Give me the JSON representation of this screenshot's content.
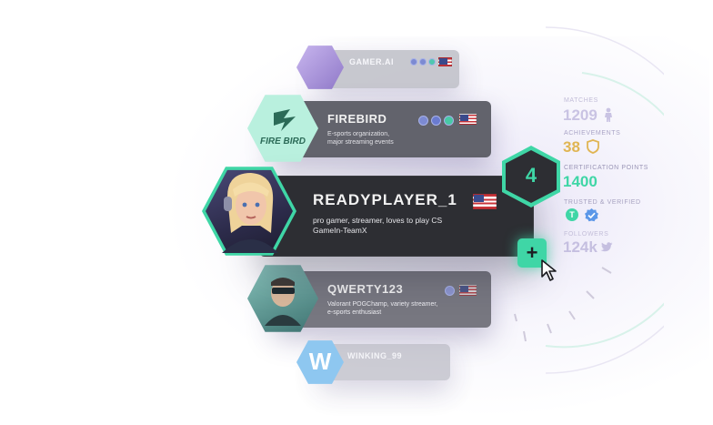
{
  "players": {
    "gamer_ai": {
      "name": "GAMER.AI"
    },
    "firebird": {
      "name": "FIREBIRD",
      "logo_text": "FIRE BIRD",
      "description": "E-sports organization,\nmajor streaming events"
    },
    "readyplayer": {
      "name": "READYPLAYER_1",
      "description": "pro gamer, streamer, loves to play CS\nGameIn-TeamX",
      "level": "4",
      "add_label": "+"
    },
    "qwerty": {
      "name": "QWERTY123",
      "description": "Valorant POGChamp, variety streamer,\ne-sports enthusiast"
    },
    "winking": {
      "name": "WINKING_99",
      "avatar_letter": "W"
    }
  },
  "stats": {
    "matches": {
      "label": "MATCHES",
      "value": "1209"
    },
    "achievements": {
      "label": "ACHIEVEMENTS",
      "value": "38"
    },
    "certification": {
      "label": "CERTIFICATION POINTS",
      "value": "1400"
    },
    "trusted": {
      "label": "TRUSTED & VERIFIED",
      "badge_letter": "T"
    },
    "followers": {
      "label": "FOLLOWERS",
      "value": "124k"
    }
  },
  "colors": {
    "accent": "#3fd6a6",
    "achievement_gold": "#e0b553",
    "card_dark": "#2d2e33",
    "stat_lavender": "#b9b2d8"
  },
  "icons": [
    "soldier-icon",
    "shield-icon",
    "twitter-bird-icon",
    "verified-check-icon",
    "cursor-icon"
  ]
}
